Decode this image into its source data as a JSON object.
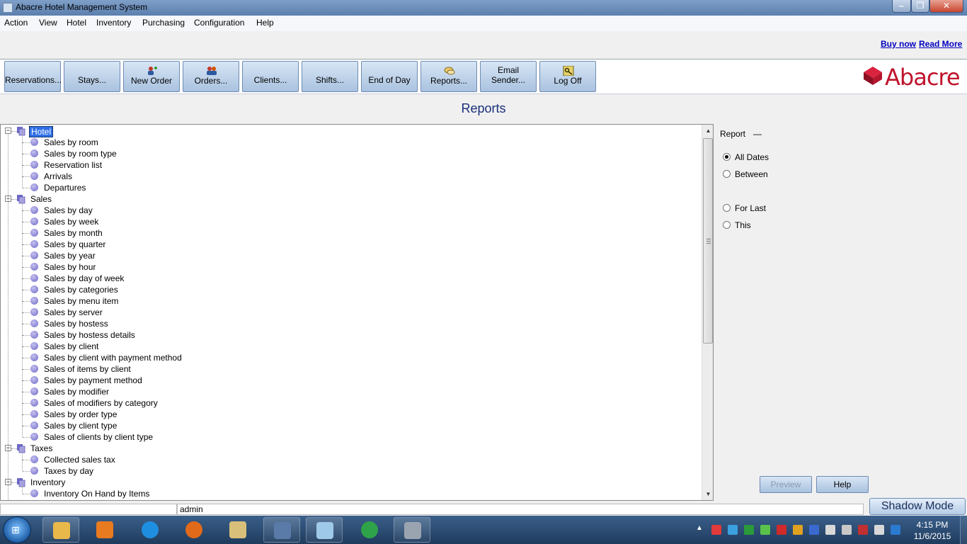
{
  "window": {
    "title": "Abacre Hotel Management System"
  },
  "menu": [
    "Action",
    "View",
    "Hotel",
    "Inventory",
    "Purchasing",
    "Configuration",
    "Help"
  ],
  "promo": {
    "buy_now": "Buy now",
    "read_more": "Read More"
  },
  "toolbar": [
    {
      "label": "Reservations...",
      "icon": "none"
    },
    {
      "label": "Stays...",
      "icon": "none"
    },
    {
      "label": "New Order",
      "icon": "new-order-icon"
    },
    {
      "label": "Orders...",
      "icon": "orders-icon"
    },
    {
      "label": "Clients...",
      "icon": "none"
    },
    {
      "label": "Shifts...",
      "icon": "none"
    },
    {
      "label": "End of Day",
      "icon": "none"
    },
    {
      "label": "Reports...",
      "icon": "reports-icon"
    },
    {
      "label": "Email Sender...",
      "icon": "none"
    },
    {
      "label": "Log Off",
      "icon": "key-icon"
    }
  ],
  "logo": {
    "text": "Abacre",
    "color": "#c0142c"
  },
  "page_title": "Reports",
  "tree": [
    {
      "label": "Hotel",
      "level": 0,
      "selected": true
    },
    {
      "label": "Sales by room",
      "level": 1
    },
    {
      "label": "Sales by room type",
      "level": 1
    },
    {
      "label": "Reservation list",
      "level": 1
    },
    {
      "label": "Arrivals",
      "level": 1
    },
    {
      "label": "Departures",
      "level": 1
    },
    {
      "label": "Sales",
      "level": 0
    },
    {
      "label": "Sales by day",
      "level": 1
    },
    {
      "label": "Sales by week",
      "level": 1
    },
    {
      "label": "Sales by month",
      "level": 1
    },
    {
      "label": "Sales by quarter",
      "level": 1
    },
    {
      "label": "Sales by year",
      "level": 1
    },
    {
      "label": "Sales by hour",
      "level": 1
    },
    {
      "label": "Sales by day of week",
      "level": 1
    },
    {
      "label": "Sales by categories",
      "level": 1
    },
    {
      "label": "Sales by menu item",
      "level": 1
    },
    {
      "label": "Sales by server",
      "level": 1
    },
    {
      "label": "Sales by hostess",
      "level": 1
    },
    {
      "label": "Sales by hostess details",
      "level": 1
    },
    {
      "label": "Sales by client",
      "level": 1
    },
    {
      "label": "Sales by client with payment method",
      "level": 1
    },
    {
      "label": "Sales of items by client",
      "level": 1
    },
    {
      "label": "Sales by payment method",
      "level": 1
    },
    {
      "label": "Sales by modifier",
      "level": 1
    },
    {
      "label": "Sales of modifiers by category",
      "level": 1
    },
    {
      "label": "Sales by order type",
      "level": 1
    },
    {
      "label": "Sales by client type",
      "level": 1
    },
    {
      "label": "Sales of clients by client type",
      "level": 1
    },
    {
      "label": "Taxes",
      "level": 0
    },
    {
      "label": "Collected sales tax",
      "level": 1
    },
    {
      "label": "Taxes by day",
      "level": 1
    },
    {
      "label": "Inventory",
      "level": 0
    },
    {
      "label": "Inventory On Hand by Items",
      "level": 1
    }
  ],
  "right_panel": {
    "report_label": "Report",
    "report_value": "—",
    "options": [
      {
        "label": "All Dates",
        "checked": true
      },
      {
        "label": "Between",
        "checked": false
      },
      {
        "label": "For Last",
        "checked": false
      },
      {
        "label": "This",
        "checked": false
      }
    ],
    "preview_label": "Preview",
    "help_label": "Help"
  },
  "statusbar": {
    "user": "admin"
  },
  "shadow_mode_label": "Shadow Mode",
  "taskbar": {
    "apps": [
      "explorer-icon",
      "media-player-icon",
      "internet-explorer-icon",
      "firefox-icon",
      "notepad-icon",
      "remote-desktop-icon",
      "paint-icon",
      "network-icon",
      "abacre-app-icon"
    ],
    "time": "4:15 PM",
    "date": "11/6/2015"
  }
}
